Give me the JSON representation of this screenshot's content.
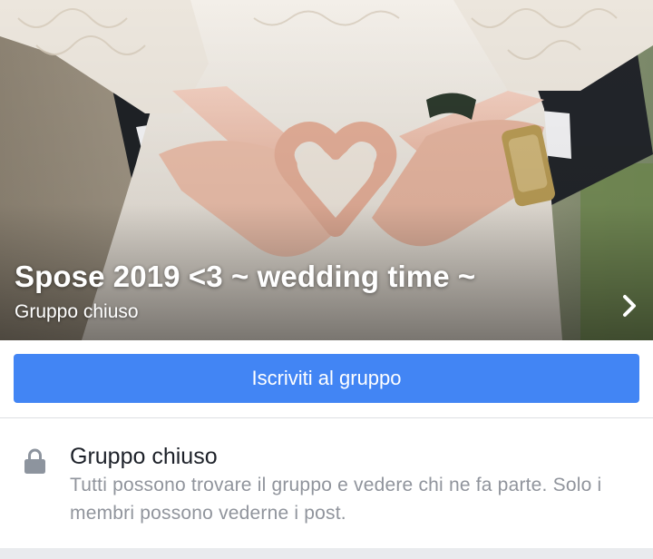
{
  "cover": {
    "title": "Spose 2019 <3 ~ wedding time ~",
    "subtitle": "Gruppo chiuso",
    "photo_alt": "",
    "chevron_icon": "chevron-right-icon"
  },
  "join": {
    "label": "Iscriviti al gruppo",
    "color": "#4285f4"
  },
  "privacy": {
    "icon": "lock-icon",
    "title": "Gruppo chiuso",
    "description": "Tutti possono trovare il gruppo e vedere chi ne fa parte. Solo i membri possono vederne i post."
  }
}
